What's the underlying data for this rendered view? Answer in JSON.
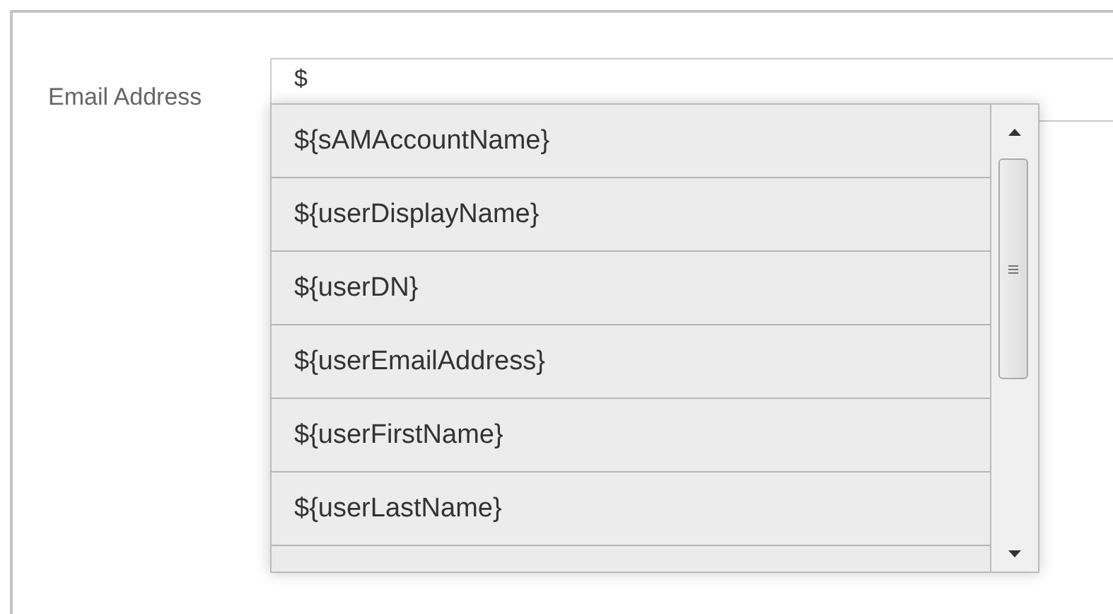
{
  "field": {
    "label": "Email Address",
    "value": "$"
  },
  "suggestions": [
    {
      "text": "${sAMAccountName}"
    },
    {
      "text": "${userDisplayName}"
    },
    {
      "text": "${userDN}"
    },
    {
      "text": "${userEmailAddress}"
    },
    {
      "text": "${userFirstName}"
    },
    {
      "text": "${userLastName}"
    }
  ]
}
